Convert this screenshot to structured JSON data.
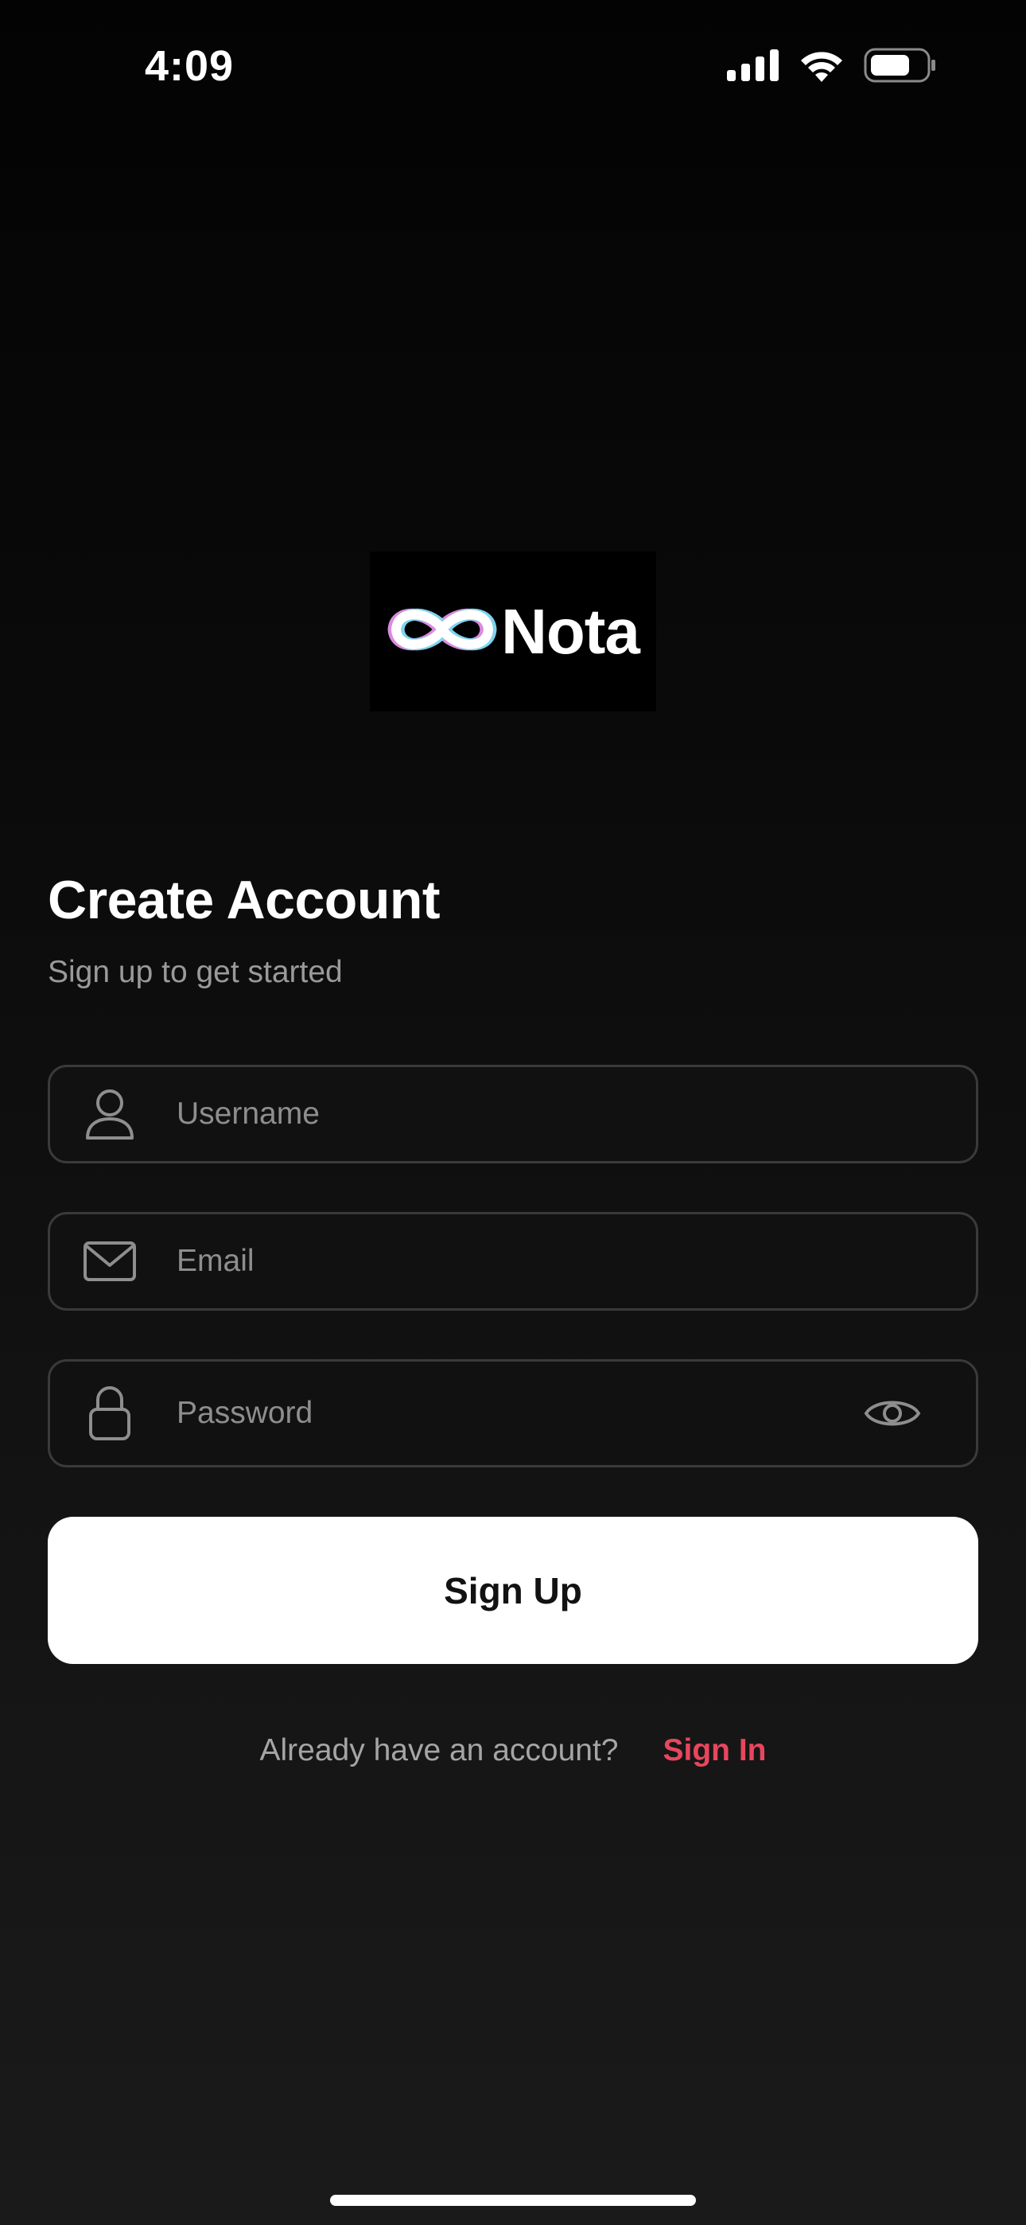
{
  "status_bar": {
    "time": "4:09",
    "icons": [
      "cellular-signal-icon",
      "wifi-icon",
      "battery-icon"
    ]
  },
  "logo": {
    "text": "Nota",
    "mark": "infinity-icon"
  },
  "header": {
    "title": "Create Account",
    "subtitle": "Sign up to get started"
  },
  "form": {
    "username": {
      "placeholder": "Username",
      "value": "",
      "icon": "person-icon"
    },
    "email": {
      "placeholder": "Email",
      "value": "",
      "icon": "envelope-icon"
    },
    "password": {
      "placeholder": "Password",
      "value": "",
      "icon": "lock-icon",
      "toggle_icon": "eye-icon"
    },
    "submit_label": "Sign Up"
  },
  "footer": {
    "question": "Already have an account?",
    "link_label": "Sign In"
  },
  "colors": {
    "background": "#0b0b0b",
    "accent": "#e8465e",
    "button_bg": "#ffffff",
    "field_border": "#3a3a3a"
  }
}
